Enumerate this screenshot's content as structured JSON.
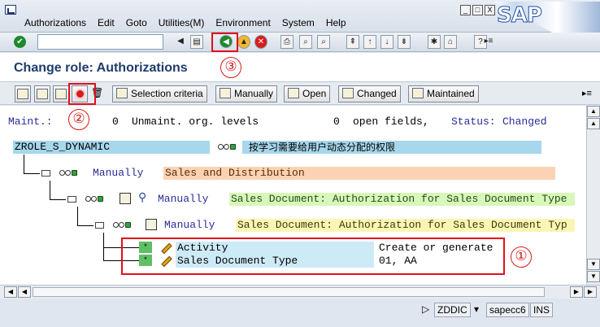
{
  "menu": {
    "items": [
      "Authorizations",
      "Edit",
      "Goto",
      "Utilities(M)",
      "Environment",
      "System",
      "Help"
    ]
  },
  "sap_logo": "SAP",
  "window": {
    "minimize": "_",
    "restore": "□",
    "close": "X"
  },
  "toolbar": {
    "command_value": ""
  },
  "title": "Change role: Authorizations",
  "app_toolbar": {
    "selection_criteria": "Selection criteria",
    "manually": "Manually",
    "open": "Open",
    "changed": "Changed",
    "maintained": "Maintained"
  },
  "header": {
    "maint_label": "Maint.:",
    "unmaint_count": "0",
    "unmaint_label": "Unmaint. org. levels",
    "open_count": "0",
    "open_label": "open fields,",
    "status_label": "Status:",
    "status_value": "Changed"
  },
  "tree": {
    "role": "ZROLE_S_DYNAMIC",
    "role_desc": "按学习需要给用户动态分配的权限",
    "level1_status": "Manually",
    "level1_text": "Sales and Distribution",
    "level2_status": "Manually",
    "level2_text": "Sales Document: Authorization for Sales Document Type",
    "level3_status": "Manually",
    "level3_text": "Sales Document: Authorization for Sales Document Typ",
    "fields": [
      {
        "name": "Activity",
        "value": "Create or generate"
      },
      {
        "name": "Sales Document Type",
        "value": "01, AA"
      }
    ]
  },
  "annotations": {
    "one": "①",
    "two": "②",
    "three": "③"
  },
  "status": {
    "client": "ZDDIC",
    "server": "sapecc6",
    "mode": "INS"
  },
  "colors": {
    "accent": "#e0101a",
    "title": "#1f3c6b",
    "role_bg": "#a6d7ec",
    "sd_bg": "#fbd3b4",
    "doc_bg": "#d9f7b8",
    "doc2_bg": "#fbf5b4",
    "field_bg": "#cdeaf7"
  }
}
